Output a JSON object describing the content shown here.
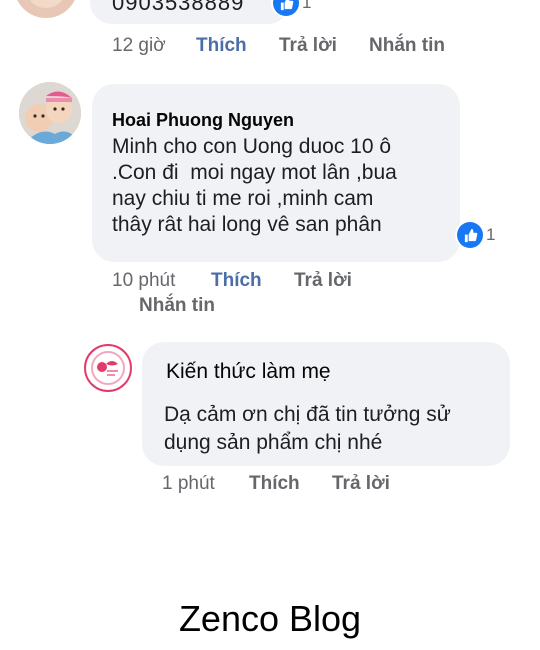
{
  "comment_top": {
    "text_partial": "0903538889",
    "reaction_count": "1",
    "time": "12 giờ",
    "like": "Thích",
    "reply": "Trả lời",
    "message": "Nhắn tin"
  },
  "comment_main": {
    "author": "Hoai Phuong Nguyen",
    "lines": [
      "Minh cho con Uong duoc 10 ô",
      ".Con đi  moi ngay mot lân ,bua",
      "nay chiu ti me roi ,minh cam",
      "thây rât hai long vê san phân"
    ],
    "reaction_count": "1",
    "time": "10 phút",
    "like": "Thích",
    "reply": "Trả lời",
    "message": "Nhắn tin"
  },
  "reply": {
    "author": "Kiến thức làm mẹ",
    "lines": [
      "Dạ cảm ơn chị đã tin tưởng sử",
      "dụng sản phẩm chị nhé"
    ],
    "time": "1 phút",
    "like": "Thích",
    "reply": "Trả lời"
  },
  "watermark": "Zenco Blog",
  "colors": {
    "bubble": "#f0f2f5",
    "link_blue": "#4c6ea8",
    "like_blue": "#1877f2",
    "meta_gray": "#65676b",
    "brand_pink": "#e23b6a"
  },
  "icons": [
    "thumbs-up-icon",
    "avatar-photo",
    "brand-logo-avatar"
  ]
}
